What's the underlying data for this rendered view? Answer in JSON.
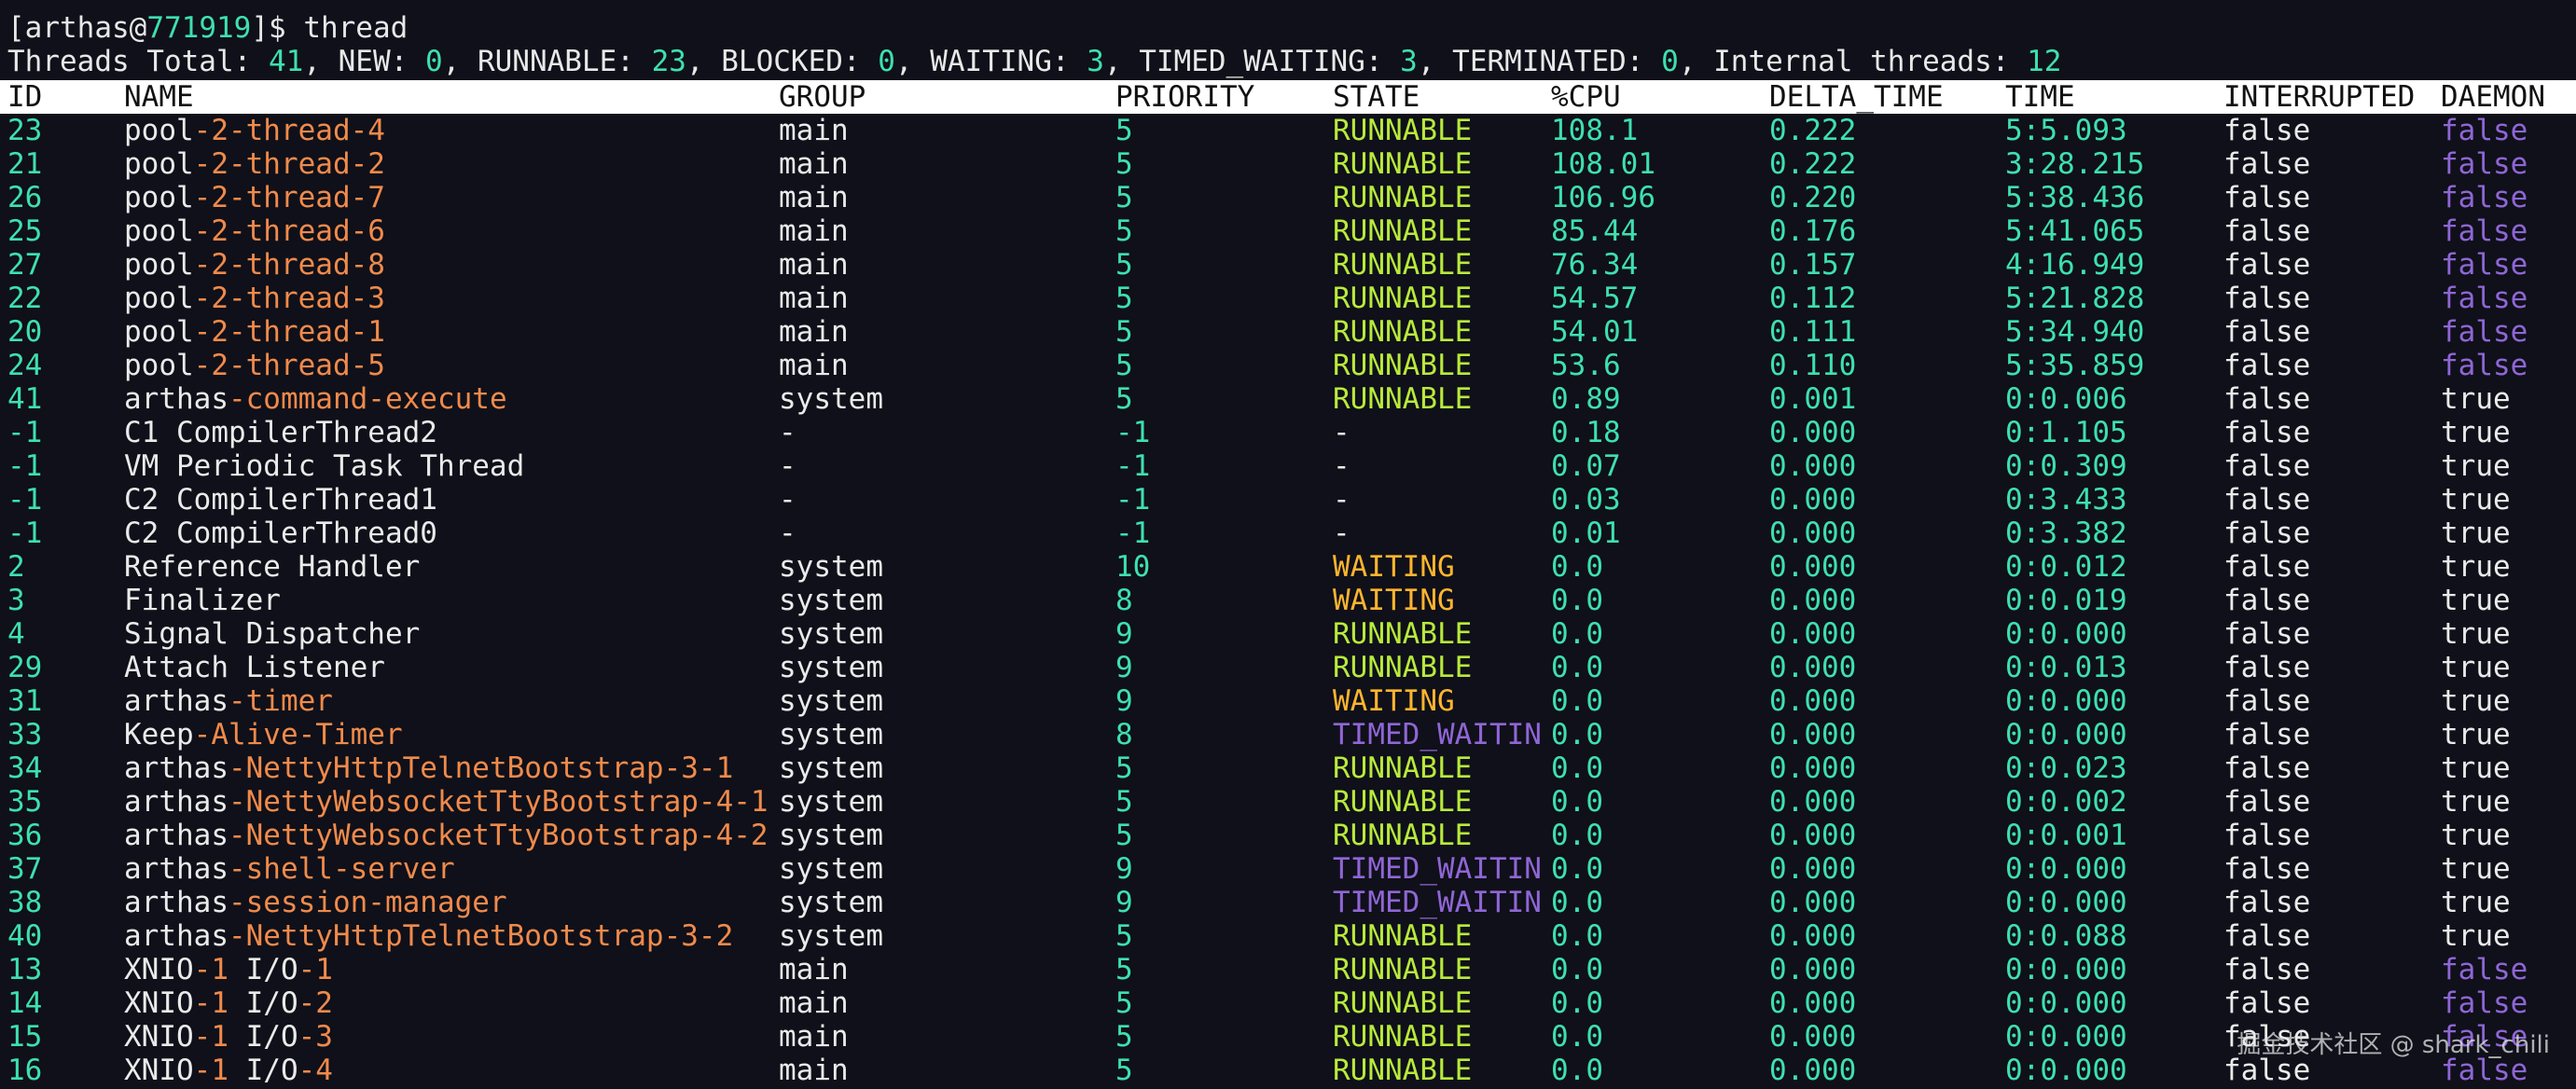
{
  "prompt": {
    "open_bracket": "[",
    "user": "arthas@",
    "pid": "771919",
    "close": "]$ ",
    "command": "thread"
  },
  "summary": {
    "total_label": "Threads Total: ",
    "total": "41",
    "new_label": ", NEW: ",
    "new": "0",
    "runnable_label": ", RUNNABLE: ",
    "runnable": "23",
    "blocked_label": ", BLOCKED: ",
    "blocked": "0",
    "waiting_label": ", WAITING: ",
    "waiting": "3",
    "timed_label": ", TIMED_WAITING: ",
    "timed": "3",
    "terminated_label": ", TERMINATED: ",
    "terminated": "0",
    "internal_label": ", Internal threads: ",
    "internal": "12"
  },
  "headers": [
    "ID",
    "NAME",
    "GROUP",
    "PRIORITY",
    "STATE",
    "%CPU",
    "DELTA_TIME",
    "TIME",
    "INTERRUPTED",
    "DAEMON"
  ],
  "colors": {
    "background": "#0f1019",
    "number": "#3ee0b0",
    "name_highlight": "#f08a4b",
    "runnable": "#b8ea3c",
    "waiting": "#ffb52e",
    "timed_waiting": "#8f66d6",
    "daemon_false": "#8f66d6"
  },
  "rows": [
    {
      "id": "23",
      "name": [
        [
          "pool",
          "w"
        ],
        [
          "-2-thread-4",
          "o"
        ]
      ],
      "group": "main",
      "priority": "5",
      "state": "RUNNABLE",
      "cpu": "108.1",
      "delta": "0.222",
      "time": "5:5.093",
      "interrupted": "false",
      "daemon": "false"
    },
    {
      "id": "21",
      "name": [
        [
          "pool",
          "w"
        ],
        [
          "-2-thread-2",
          "o"
        ]
      ],
      "group": "main",
      "priority": "5",
      "state": "RUNNABLE",
      "cpu": "108.01",
      "delta": "0.222",
      "time": "3:28.215",
      "interrupted": "false",
      "daemon": "false"
    },
    {
      "id": "26",
      "name": [
        [
          "pool",
          "w"
        ],
        [
          "-2-thread-7",
          "o"
        ]
      ],
      "group": "main",
      "priority": "5",
      "state": "RUNNABLE",
      "cpu": "106.96",
      "delta": "0.220",
      "time": "5:38.436",
      "interrupted": "false",
      "daemon": "false"
    },
    {
      "id": "25",
      "name": [
        [
          "pool",
          "w"
        ],
        [
          "-2-thread-6",
          "o"
        ]
      ],
      "group": "main",
      "priority": "5",
      "state": "RUNNABLE",
      "cpu": "85.44",
      "delta": "0.176",
      "time": "5:41.065",
      "interrupted": "false",
      "daemon": "false"
    },
    {
      "id": "27",
      "name": [
        [
          "pool",
          "w"
        ],
        [
          "-2-thread-8",
          "o"
        ]
      ],
      "group": "main",
      "priority": "5",
      "state": "RUNNABLE",
      "cpu": "76.34",
      "delta": "0.157",
      "time": "4:16.949",
      "interrupted": "false",
      "daemon": "false"
    },
    {
      "id": "22",
      "name": [
        [
          "pool",
          "w"
        ],
        [
          "-2-thread-3",
          "o"
        ]
      ],
      "group": "main",
      "priority": "5",
      "state": "RUNNABLE",
      "cpu": "54.57",
      "delta": "0.112",
      "time": "5:21.828",
      "interrupted": "false",
      "daemon": "false"
    },
    {
      "id": "20",
      "name": [
        [
          "pool",
          "w"
        ],
        [
          "-2-thread-1",
          "o"
        ]
      ],
      "group": "main",
      "priority": "5",
      "state": "RUNNABLE",
      "cpu": "54.01",
      "delta": "0.111",
      "time": "5:34.940",
      "interrupted": "false",
      "daemon": "false"
    },
    {
      "id": "24",
      "name": [
        [
          "pool",
          "w"
        ],
        [
          "-2-thread-5",
          "o"
        ]
      ],
      "group": "main",
      "priority": "5",
      "state": "RUNNABLE",
      "cpu": "53.6",
      "delta": "0.110",
      "time": "5:35.859",
      "interrupted": "false",
      "daemon": "false"
    },
    {
      "id": "41",
      "name": [
        [
          "arthas",
          "w"
        ],
        [
          "-command-execute",
          "o"
        ]
      ],
      "group": "system",
      "priority": "5",
      "state": "RUNNABLE",
      "cpu": "0.89",
      "delta": "0.001",
      "time": "0:0.006",
      "interrupted": "false",
      "daemon": "true"
    },
    {
      "id": "-1",
      "name": [
        [
          "C1 CompilerThread2",
          "w"
        ]
      ],
      "group": "-",
      "priority": "-1",
      "state": "-",
      "cpu": "0.18",
      "delta": "0.000",
      "time": "0:1.105",
      "interrupted": "false",
      "daemon": "true"
    },
    {
      "id": "-1",
      "name": [
        [
          "VM Periodic Task Thread",
          "w"
        ]
      ],
      "group": "-",
      "priority": "-1",
      "state": "-",
      "cpu": "0.07",
      "delta": "0.000",
      "time": "0:0.309",
      "interrupted": "false",
      "daemon": "true"
    },
    {
      "id": "-1",
      "name": [
        [
          "C2 CompilerThread1",
          "w"
        ]
      ],
      "group": "-",
      "priority": "-1",
      "state": "-",
      "cpu": "0.03",
      "delta": "0.000",
      "time": "0:3.433",
      "interrupted": "false",
      "daemon": "true"
    },
    {
      "id": "-1",
      "name": [
        [
          "C2 CompilerThread0",
          "w"
        ]
      ],
      "group": "-",
      "priority": "-1",
      "state": "-",
      "cpu": "0.01",
      "delta": "0.000",
      "time": "0:3.382",
      "interrupted": "false",
      "daemon": "true"
    },
    {
      "id": "2",
      "name": [
        [
          "Reference Handler",
          "w"
        ]
      ],
      "group": "system",
      "priority": "10",
      "state": "WAITING",
      "cpu": "0.0",
      "delta": "0.000",
      "time": "0:0.012",
      "interrupted": "false",
      "daemon": "true"
    },
    {
      "id": "3",
      "name": [
        [
          "Finalizer",
          "w"
        ]
      ],
      "group": "system",
      "priority": "8",
      "state": "WAITING",
      "cpu": "0.0",
      "delta": "0.000",
      "time": "0:0.019",
      "interrupted": "false",
      "daemon": "true"
    },
    {
      "id": "4",
      "name": [
        [
          "Signal Dispatcher",
          "w"
        ]
      ],
      "group": "system",
      "priority": "9",
      "state": "RUNNABLE",
      "cpu": "0.0",
      "delta": "0.000",
      "time": "0:0.000",
      "interrupted": "false",
      "daemon": "true"
    },
    {
      "id": "29",
      "name": [
        [
          "Attach Listener",
          "w"
        ]
      ],
      "group": "system",
      "priority": "9",
      "state": "RUNNABLE",
      "cpu": "0.0",
      "delta": "0.000",
      "time": "0:0.013",
      "interrupted": "false",
      "daemon": "true"
    },
    {
      "id": "31",
      "name": [
        [
          "arthas",
          "w"
        ],
        [
          "-timer",
          "o"
        ]
      ],
      "group": "system",
      "priority": "9",
      "state": "WAITING",
      "cpu": "0.0",
      "delta": "0.000",
      "time": "0:0.000",
      "interrupted": "false",
      "daemon": "true"
    },
    {
      "id": "33",
      "name": [
        [
          "Keep",
          "w"
        ],
        [
          "-Alive-Timer",
          "o"
        ]
      ],
      "group": "system",
      "priority": "8",
      "state": "TIMED_WAITIN",
      "cpu": "0.0",
      "delta": "0.000",
      "time": "0:0.000",
      "interrupted": "false",
      "daemon": "true"
    },
    {
      "id": "34",
      "name": [
        [
          "arthas",
          "w"
        ],
        [
          "-NettyHttpTelnetBootstrap-3-1",
          "o"
        ]
      ],
      "group": "system",
      "priority": "5",
      "state": "RUNNABLE",
      "cpu": "0.0",
      "delta": "0.000",
      "time": "0:0.023",
      "interrupted": "false",
      "daemon": "true"
    },
    {
      "id": "35",
      "name": [
        [
          "arthas",
          "w"
        ],
        [
          "-NettyWebsocketTtyBootstrap-4-1",
          "o"
        ]
      ],
      "group": "system",
      "priority": "5",
      "state": "RUNNABLE",
      "cpu": "0.0",
      "delta": "0.000",
      "time": "0:0.002",
      "interrupted": "false",
      "daemon": "true"
    },
    {
      "id": "36",
      "name": [
        [
          "arthas",
          "w"
        ],
        [
          "-NettyWebsocketTtyBootstrap-4-2",
          "o"
        ]
      ],
      "group": "system",
      "priority": "5",
      "state": "RUNNABLE",
      "cpu": "0.0",
      "delta": "0.000",
      "time": "0:0.001",
      "interrupted": "false",
      "daemon": "true"
    },
    {
      "id": "37",
      "name": [
        [
          "arthas",
          "w"
        ],
        [
          "-shell-server",
          "o"
        ]
      ],
      "group": "system",
      "priority": "9",
      "state": "TIMED_WAITIN",
      "cpu": "0.0",
      "delta": "0.000",
      "time": "0:0.000",
      "interrupted": "false",
      "daemon": "true"
    },
    {
      "id": "38",
      "name": [
        [
          "arthas",
          "w"
        ],
        [
          "-session-manager",
          "o"
        ]
      ],
      "group": "system",
      "priority": "9",
      "state": "TIMED_WAITIN",
      "cpu": "0.0",
      "delta": "0.000",
      "time": "0:0.000",
      "interrupted": "false",
      "daemon": "true"
    },
    {
      "id": "40",
      "name": [
        [
          "arthas",
          "w"
        ],
        [
          "-NettyHttpTelnetBootstrap-3-2",
          "o"
        ]
      ],
      "group": "system",
      "priority": "5",
      "state": "RUNNABLE",
      "cpu": "0.0",
      "delta": "0.000",
      "time": "0:0.088",
      "interrupted": "false",
      "daemon": "true"
    },
    {
      "id": "13",
      "name": [
        [
          "XNIO",
          "w"
        ],
        [
          "-1",
          "o"
        ],
        [
          " I/O",
          "w"
        ],
        [
          "-1",
          "o"
        ]
      ],
      "group": "main",
      "priority": "5",
      "state": "RUNNABLE",
      "cpu": "0.0",
      "delta": "0.000",
      "time": "0:0.000",
      "interrupted": "false",
      "daemon": "false"
    },
    {
      "id": "14",
      "name": [
        [
          "XNIO",
          "w"
        ],
        [
          "-1",
          "o"
        ],
        [
          " I/O",
          "w"
        ],
        [
          "-2",
          "o"
        ]
      ],
      "group": "main",
      "priority": "5",
      "state": "RUNNABLE",
      "cpu": "0.0",
      "delta": "0.000",
      "time": "0:0.000",
      "interrupted": "false",
      "daemon": "false"
    },
    {
      "id": "15",
      "name": [
        [
          "XNIO",
          "w"
        ],
        [
          "-1",
          "o"
        ],
        [
          " I/O",
          "w"
        ],
        [
          "-3",
          "o"
        ]
      ],
      "group": "main",
      "priority": "5",
      "state": "RUNNABLE",
      "cpu": "0.0",
      "delta": "0.000",
      "time": "0:0.000",
      "interrupted": "false",
      "daemon": "false"
    },
    {
      "id": "16",
      "name": [
        [
          "XNIO",
          "w"
        ],
        [
          "-1",
          "o"
        ],
        [
          " I/O",
          "w"
        ],
        [
          "-4",
          "o"
        ]
      ],
      "group": "main",
      "priority": "5",
      "state": "RUNNABLE",
      "cpu": "0.0",
      "delta": "0.000",
      "time": "0:0.000",
      "interrupted": "false",
      "daemon": "false"
    }
  ],
  "watermark": "掘金技术社区 @ shark_chili"
}
